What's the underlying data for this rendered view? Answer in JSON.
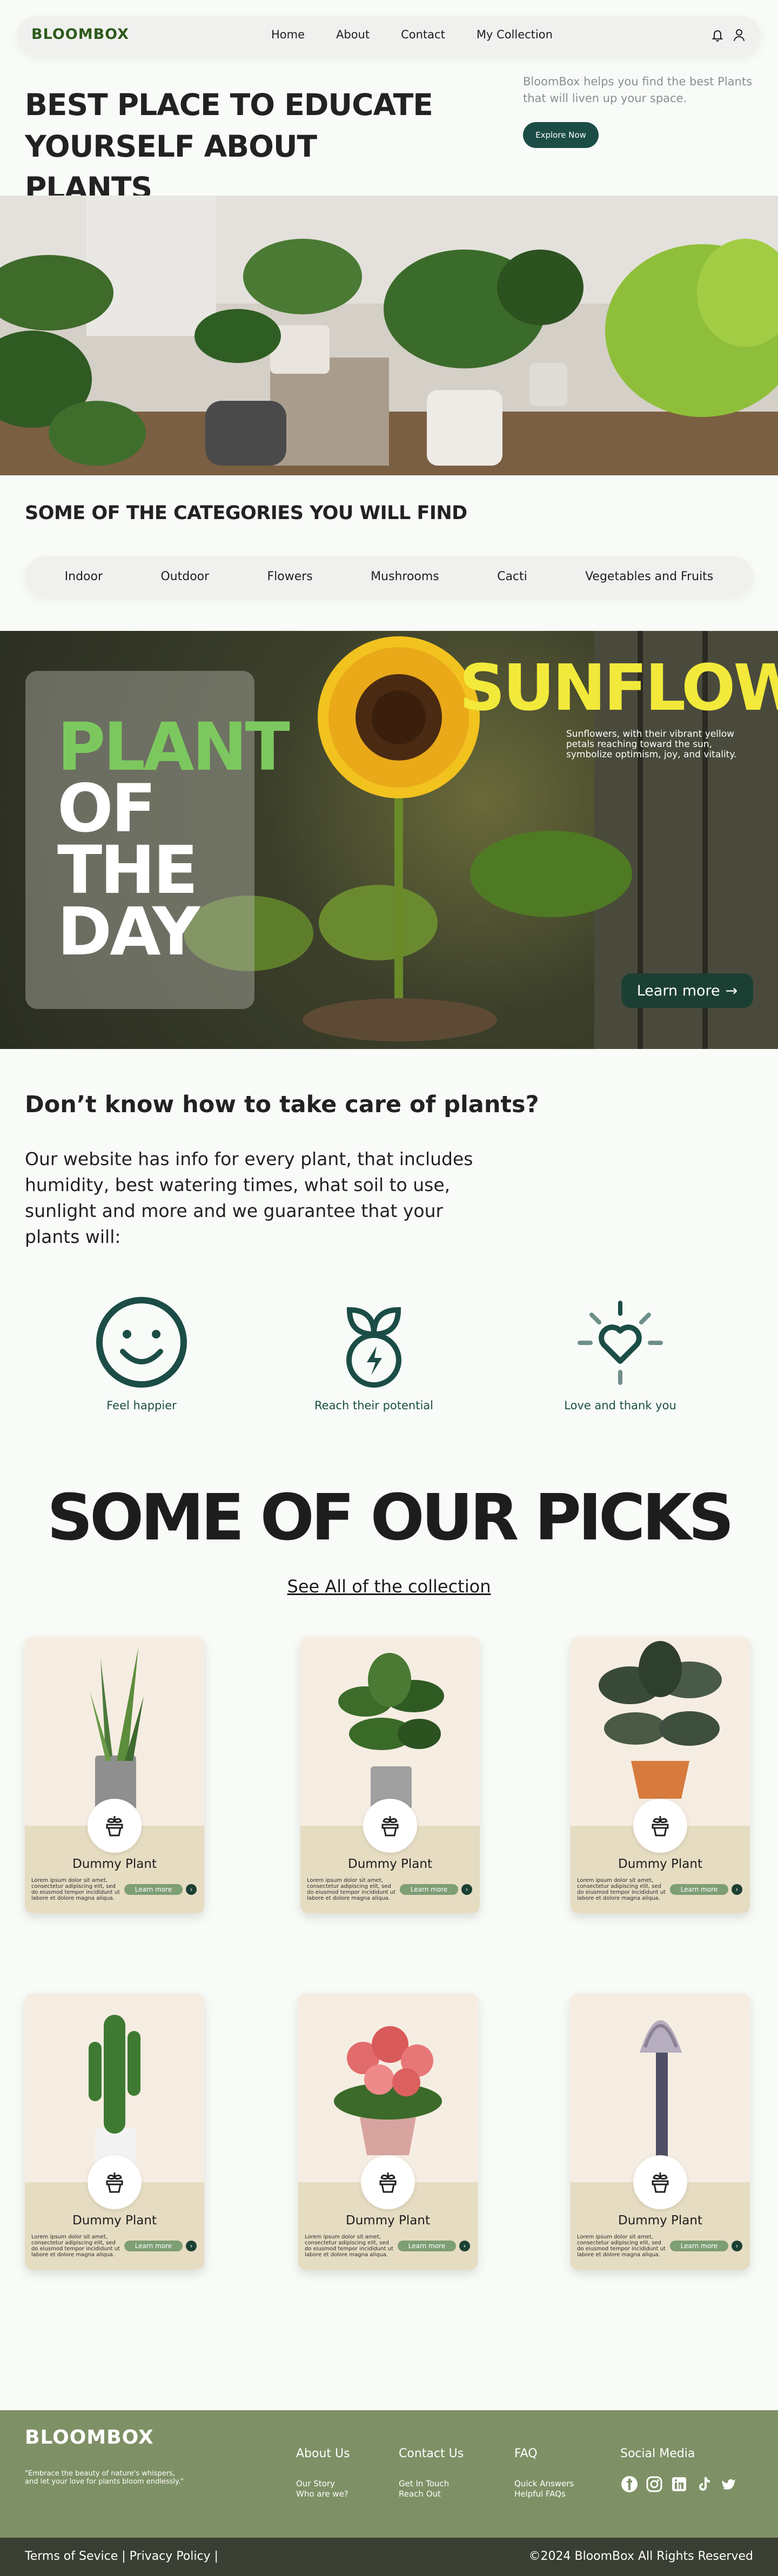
{
  "nav": {
    "logo": "BLOOMBOX",
    "links": [
      "Home",
      "About",
      "Contact",
      "My Collection"
    ],
    "icons": [
      "bell-icon",
      "user-icon"
    ]
  },
  "hero": {
    "title": "BEST PLACE TO EDUCATE YOURSELF ABOUT PLANTS",
    "description": "BloomBox helps you find the best Plants that will liven up your space.",
    "button": "Explore Now"
  },
  "categories": {
    "title": "SOME OF THE CATEGORIES YOU WILL FIND",
    "items": [
      "Indoor",
      "Outdoor",
      "Flowers",
      "Mushrooms",
      "Cacti",
      "Vegetables and Fruits"
    ]
  },
  "plant_of_day": {
    "word1": "PLANT",
    "word2": "OF",
    "word3": "THE",
    "word4": "DAY",
    "name": "SUNFLOWER",
    "description": "Sunflowers, with their vibrant yellow petals reaching toward the sun, symbolize optimism, joy, and vitality.",
    "button": "Learn more",
    "colors": {
      "plant": "#7cc85f",
      "name": "#f2e93b"
    }
  },
  "care": {
    "title": "Don’t know how to take care of plants?",
    "text": "Our website has info for every plant, that includes humidity, best watering times, what soil to use, sunlight and more and we guarantee that your plants will:",
    "benefits": [
      "Feel happier",
      "Reach their potential",
      "Love and thank you"
    ]
  },
  "picks": {
    "title": "SOME OF OUR PICKS",
    "link": "See All of the collection",
    "cards": [
      {
        "name": "Dummy Plant",
        "desc": "Lorem ipsum dolor sit amet, consectetur adipiscing elit, sed do eiusmod tempor incididunt ut labore et dolore magna aliqua.",
        "button": "Learn more"
      },
      {
        "name": "Dummy Plant",
        "desc": "Lorem ipsum dolor sit amet, consectetur adipiscing elit, sed do eiusmod tempor incididunt ut labore et dolore magna aliqua.",
        "button": "Learn more"
      },
      {
        "name": "Dummy Plant",
        "desc": "Lorem ipsum dolor sit amet, consectetur adipiscing elit, sed do eiusmod tempor incididunt ut labore et dolore magna aliqua.",
        "button": "Learn more"
      },
      {
        "name": "Dummy Plant",
        "desc": "Lorem ipsum dolor sit amet, consectetur adipiscing elit, sed do eiusmod tempor incididunt ut labore et dolore magna aliqua.",
        "button": "Learn more"
      },
      {
        "name": "Dummy Plant",
        "desc": "Lorem ipsum dolor sit amet, consectetur adipiscing elit, sed do eiusmod tempor incididunt ut labore et dolore magna aliqua.",
        "button": "Learn more"
      },
      {
        "name": "Dummy Plant",
        "desc": "Lorem ipsum dolor sit amet, consectetur adipiscing elit, sed do eiusmod tempor incididunt ut labore et dolore magna aliqua.",
        "button": "Learn more"
      }
    ]
  },
  "footer": {
    "logo": "BLOOMBOX",
    "quote": "\"Embrace the beauty of nature's whispers, and let your love for plants bloom endlessly.\"",
    "columns": [
      {
        "title": "About Us",
        "links": [
          "Our Story",
          "Who are we?"
        ]
      },
      {
        "title": "Contact Us",
        "links": [
          "Get In Touch",
          "Reach Out"
        ]
      },
      {
        "title": "FAQ",
        "links": [
          "Quick Answers",
          "Helpful FAQs"
        ]
      }
    ],
    "social_title": "Social Media",
    "social_icons": [
      "facebook-icon",
      "instagram-icon",
      "linkedin-icon",
      "tiktok-icon",
      "twitter-icon"
    ],
    "bottom_left": "Terms of Sevice | Privacy Policy |",
    "bottom_right": "©2024 BloomBox All Rights Reserved"
  }
}
